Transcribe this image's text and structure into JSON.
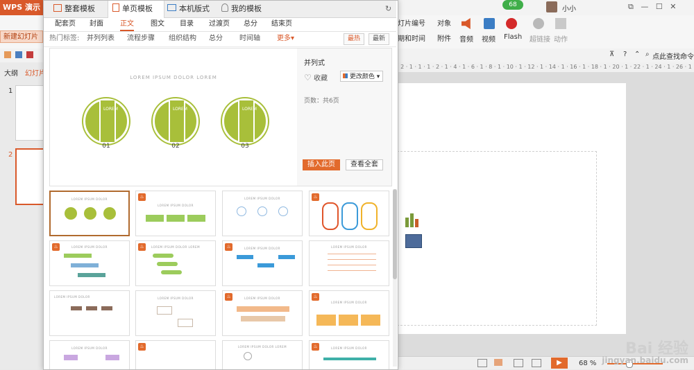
{
  "app": {
    "title": "WPS 演示",
    "new_slide": "新建幻灯片",
    "notification_count": "68",
    "user": "小小",
    "outline_tab": "大纲",
    "slides_tab": "幻灯片",
    "slide_numbers": [
      "1",
      "2"
    ],
    "ribbon": {
      "slide_number": "灯片编号",
      "object": "对象",
      "date_time": "期和时间",
      "attachment": "附件",
      "audio": "音频",
      "video": "视频",
      "flash": "Flash",
      "hyperlink": "超链接",
      "action": "动作"
    },
    "find_cmd": "点此查找命令",
    "zoom": "68 %",
    "ruler_text": "· 2 · 1 · 1 · 1 · 2 · 1 · 4 · 1 · 6 · 1 · 8 · 1 · 10 · 1 · 12 · 1 · 14 · 1 · 16 · 1 · 18 · 1 · 20 · 1 · 22 · 1 · 24 · 1 · 26 · 1 · 28"
  },
  "dialog": {
    "tabs": [
      "整套模板",
      "单页模板",
      "本机版式",
      "我的模板"
    ],
    "active_tab": "单页模板",
    "categories": [
      "配套页",
      "封面",
      "正文",
      "图文",
      "目录",
      "过渡页",
      "总分",
      "结束页"
    ],
    "active_category": "正文",
    "hot_tags_label": "热门标签:",
    "tags": [
      "并列列表",
      "流程步骤",
      "组织结构",
      "总分",
      "时间轴"
    ],
    "more": "更多▾",
    "sort_hot": "最热",
    "sort_new": "最新",
    "preview": {
      "title": "LOREM IPSUM DOLOR LOREM",
      "items": [
        {
          "num": "01",
          "text": "LOREM"
        },
        {
          "num": "02",
          "text": "LOREM"
        },
        {
          "num": "03",
          "text": "LOREM"
        }
      ],
      "accent": "#a8bf3a"
    },
    "side": {
      "name": "并列式",
      "favorite": "收藏",
      "change_color": "更改颜色",
      "pages": "页数：共6页",
      "insert": "插入此页",
      "view_all": "查看全套"
    },
    "cards": [
      {
        "title": "LOREM IPSUM DOLOR",
        "style": "circles-green",
        "hot": false
      },
      {
        "title": "LOREM IPSUM DOLOR",
        "style": "boxes-green",
        "hot": true
      },
      {
        "title": "LOREM IPSUM DOLOR",
        "style": "circles-light",
        "hot": false
      },
      {
        "title": "",
        "style": "bulbs-color",
        "hot": true
      },
      {
        "title": "LOREM IPSUM DOLOR",
        "style": "bars-green",
        "hot": true
      },
      {
        "title": "LOREM IPSUM DOLOR LOREM",
        "style": "bubbles-green",
        "hot": true
      },
      {
        "title": "LOREM IPSUM DOLOR",
        "style": "ribbons-blue",
        "hot": true
      },
      {
        "title": "LOREM IPSUM DOLOR",
        "style": "lines-orange",
        "hot": false
      },
      {
        "title": "LOREM IPSUM DOLOR",
        "style": "boxes-brown",
        "hot": false
      },
      {
        "title": "LOREM IPSUM DOLOR",
        "style": "outline-boxes",
        "hot": false
      },
      {
        "title": "LOREM IPSUM DOLOR",
        "style": "banners-orange",
        "hot": true
      },
      {
        "title": "LOREM IPSUM DOLOR",
        "style": "folders-orange",
        "hot": true
      },
      {
        "title": "LOREM IPSUM DOLOR",
        "style": "purple",
        "hot": false
      },
      {
        "title": "",
        "style": "blank",
        "hot": true
      },
      {
        "title": "LOREM IPSUM DOLOR LOREM",
        "style": "list",
        "hot": false
      },
      {
        "title": "LOREM IPSUM DOLOR",
        "style": "teal",
        "hot": true
      }
    ]
  },
  "watermark": {
    "line1": "Bai 经验",
    "line2": "jingyan.baidu.com"
  }
}
